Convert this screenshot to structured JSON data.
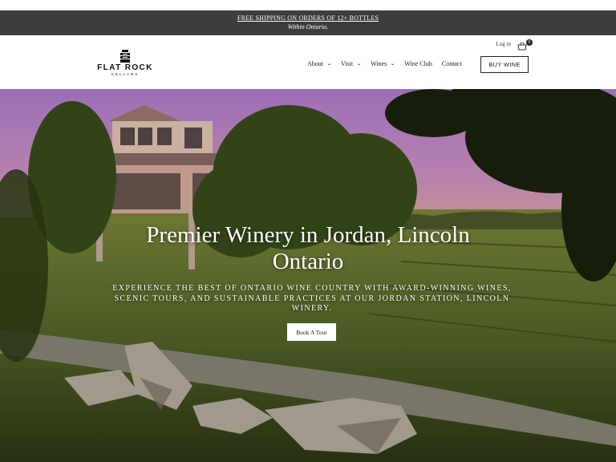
{
  "announcement": {
    "line1": "FREE SHIPPING ON ORDERS OF 12+ BOTTLES",
    "line2": "Within Ontario."
  },
  "header": {
    "logo_name": "FLAT ROCK",
    "logo_sub": "CELLARS",
    "login_label": "Log in",
    "cart_count": "0",
    "nav": [
      {
        "label": "About",
        "has_dropdown": true
      },
      {
        "label": "Visit",
        "has_dropdown": true
      },
      {
        "label": "Wines",
        "has_dropdown": true
      },
      {
        "label": "Wine Club",
        "has_dropdown": false
      },
      {
        "label": "Contact",
        "has_dropdown": false
      }
    ],
    "buy_label": "BUY WINE",
    "icons": {
      "cart": "cart-icon",
      "chevron": "chevron-down-icon",
      "logo": "winery-logo-icon"
    }
  },
  "hero": {
    "title_line1": "Premier Winery in Jordan, Lincoln",
    "title_line2": "Ontario",
    "subtitle": "EXPERIENCE THE BEST OF ONTARIO WINE COUNTRY WITH AWARD-WINNING WINES, SCENIC TOURS, AND SUSTAINABLE PRACTICES AT OUR JORDAN STATION, LINCOLN WINERY.",
    "cta_label": "Book A Tour"
  },
  "colors": {
    "announcement_bg": "#3d3d3c",
    "sky": "#c990cf",
    "text": "#222222"
  }
}
